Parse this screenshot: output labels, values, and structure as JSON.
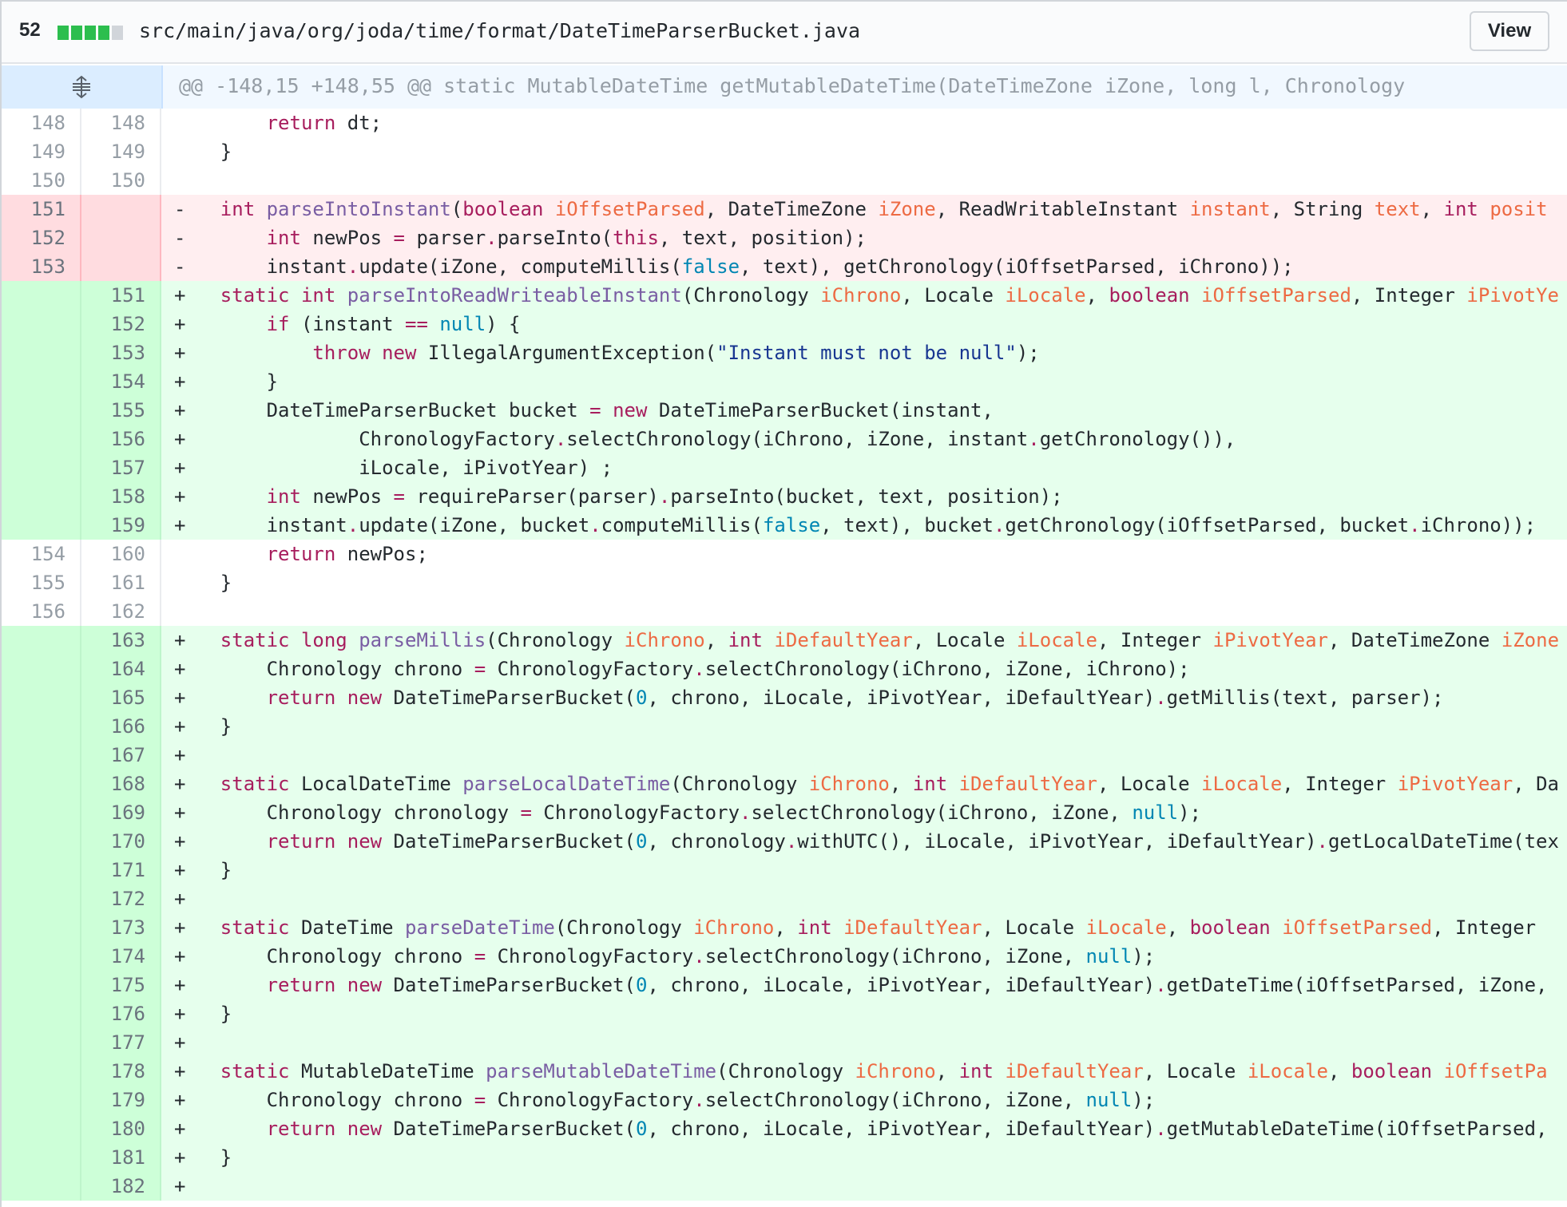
{
  "file": {
    "additions_count": "52",
    "path": "src/main/java/org/joda/time/format/DateTimeParserBucket.java",
    "view_label": "View",
    "hunk_header": "@@ -148,15 +148,55 @@ static MutableDateTime getMutableDateTime(DateTimeZone iZone, long l, Chronology"
  },
  "colors": {
    "addition": "#e6ffed",
    "deletion": "#ffeef0",
    "hunk": "#f1f8ff"
  },
  "lines": [
    {
      "type": "ctx",
      "old": "148",
      "new": "148",
      "text": "        return dt;"
    },
    {
      "type": "ctx",
      "old": "149",
      "new": "149",
      "text": "    }"
    },
    {
      "type": "ctx",
      "old": "150",
      "new": "150",
      "text": ""
    },
    {
      "type": "del",
      "old": "151",
      "new": "",
      "text": "-   int parseIntoInstant(boolean iOffsetParsed, DateTimeZone iZone, ReadWritableInstant instant, String text, int posit"
    },
    {
      "type": "del",
      "old": "152",
      "new": "",
      "text": "-       int newPos = parser.parseInto(this, text, position);"
    },
    {
      "type": "del",
      "old": "153",
      "new": "",
      "text": "-       instant.update(iZone, computeMillis(false, text), getChronology(iOffsetParsed, iChrono));"
    },
    {
      "type": "add",
      "old": "",
      "new": "151",
      "text": "+   static int parseIntoReadWriteableInstant(Chronology iChrono, Locale iLocale, boolean iOffsetParsed, Integer iPivotYe"
    },
    {
      "type": "add",
      "old": "",
      "new": "152",
      "text": "+       if (instant == null) {"
    },
    {
      "type": "add",
      "old": "",
      "new": "153",
      "text": "+           throw new IllegalArgumentException(\"Instant must not be null\");"
    },
    {
      "type": "add",
      "old": "",
      "new": "154",
      "text": "+       }"
    },
    {
      "type": "add",
      "old": "",
      "new": "155",
      "text": "+       DateTimeParserBucket bucket = new DateTimeParserBucket(instant,"
    },
    {
      "type": "add",
      "old": "",
      "new": "156",
      "text": "+               ChronologyFactory.selectChronology(iChrono, iZone, instant.getChronology()),"
    },
    {
      "type": "add",
      "old": "",
      "new": "157",
      "text": "+               iLocale, iPivotYear) ;"
    },
    {
      "type": "add",
      "old": "",
      "new": "158",
      "text": "+       int newPos = requireParser(parser).parseInto(bucket, text, position);"
    },
    {
      "type": "add",
      "old": "",
      "new": "159",
      "text": "+       instant.update(iZone, bucket.computeMillis(false, text), bucket.getChronology(iOffsetParsed, bucket.iChrono));"
    },
    {
      "type": "ctx",
      "old": "154",
      "new": "160",
      "text": "        return newPos;"
    },
    {
      "type": "ctx",
      "old": "155",
      "new": "161",
      "text": "    }"
    },
    {
      "type": "ctx",
      "old": "156",
      "new": "162",
      "text": ""
    },
    {
      "type": "add",
      "old": "",
      "new": "163",
      "text": "+   static long parseMillis(Chronology iChrono, int iDefaultYear, Locale iLocale, Integer iPivotYear, DateTimeZone iZone"
    },
    {
      "type": "add",
      "old": "",
      "new": "164",
      "text": "+       Chronology chrono = ChronologyFactory.selectChronology(iChrono, iZone, iChrono);"
    },
    {
      "type": "add",
      "old": "",
      "new": "165",
      "text": "+       return new DateTimeParserBucket(0, chrono, iLocale, iPivotYear, iDefaultYear).getMillis(text, parser);"
    },
    {
      "type": "add",
      "old": "",
      "new": "166",
      "text": "+   }"
    },
    {
      "type": "add",
      "old": "",
      "new": "167",
      "text": "+"
    },
    {
      "type": "add",
      "old": "",
      "new": "168",
      "text": "+   static LocalDateTime parseLocalDateTime(Chronology iChrono, int iDefaultYear, Locale iLocale, Integer iPivotYear, Da"
    },
    {
      "type": "add",
      "old": "",
      "new": "169",
      "text": "+       Chronology chronology = ChronologyFactory.selectChronology(iChrono, iZone, null);"
    },
    {
      "type": "add",
      "old": "",
      "new": "170",
      "text": "+       return new DateTimeParserBucket(0, chronology.withUTC(), iLocale, iPivotYear, iDefaultYear).getLocalDateTime(tex"
    },
    {
      "type": "add",
      "old": "",
      "new": "171",
      "text": "+   }"
    },
    {
      "type": "add",
      "old": "",
      "new": "172",
      "text": "+"
    },
    {
      "type": "add",
      "old": "",
      "new": "173",
      "text": "+   static DateTime parseDateTime(Chronology iChrono, int iDefaultYear, Locale iLocale, boolean iOffsetParsed, Integer"
    },
    {
      "type": "add",
      "old": "",
      "new": "174",
      "text": "+       Chronology chrono = ChronologyFactory.selectChronology(iChrono, iZone, null);"
    },
    {
      "type": "add",
      "old": "",
      "new": "175",
      "text": "+       return new DateTimeParserBucket(0, chrono, iLocale, iPivotYear, iDefaultYear).getDateTime(iOffsetParsed, iZone,"
    },
    {
      "type": "add",
      "old": "",
      "new": "176",
      "text": "+   }"
    },
    {
      "type": "add",
      "old": "",
      "new": "177",
      "text": "+"
    },
    {
      "type": "add",
      "old": "",
      "new": "178",
      "text": "+   static MutableDateTime parseMutableDateTime(Chronology iChrono, int iDefaultYear, Locale iLocale, boolean iOffsetPa"
    },
    {
      "type": "add",
      "old": "",
      "new": "179",
      "text": "+       Chronology chrono = ChronologyFactory.selectChronology(iChrono, iZone, null);"
    },
    {
      "type": "add",
      "old": "",
      "new": "180",
      "text": "+       return new DateTimeParserBucket(0, chrono, iLocale, iPivotYear, iDefaultYear).getMutableDateTime(iOffsetParsed,"
    },
    {
      "type": "add",
      "old": "",
      "new": "181",
      "text": "+   }"
    },
    {
      "type": "add",
      "old": "",
      "new": "182",
      "text": "+"
    }
  ]
}
